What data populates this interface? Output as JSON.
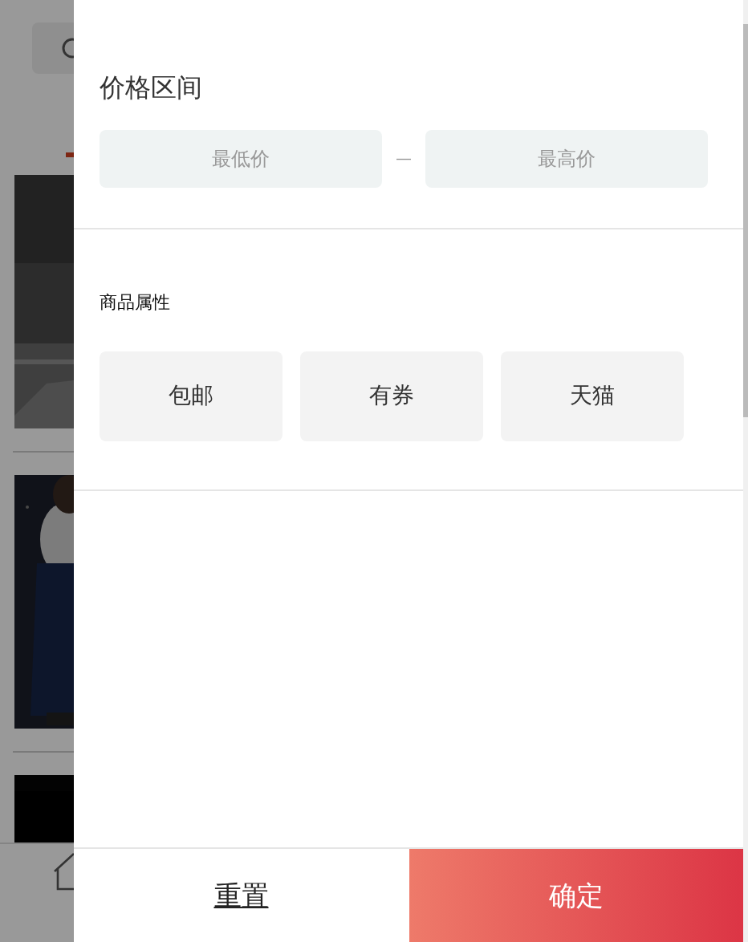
{
  "price_range": {
    "title": "价格区间",
    "min": {
      "placeholder": "最低价"
    },
    "separator": "—",
    "max": {
      "placeholder": "最高价"
    }
  },
  "attributes": {
    "title": "商品属性",
    "tags": [
      {
        "label": "包邮",
        "selected": false
      },
      {
        "label": "有券",
        "selected": false
      },
      {
        "label": "天猫",
        "selected": false
      }
    ]
  },
  "footer": {
    "reset": "重置",
    "confirm": "确定"
  }
}
